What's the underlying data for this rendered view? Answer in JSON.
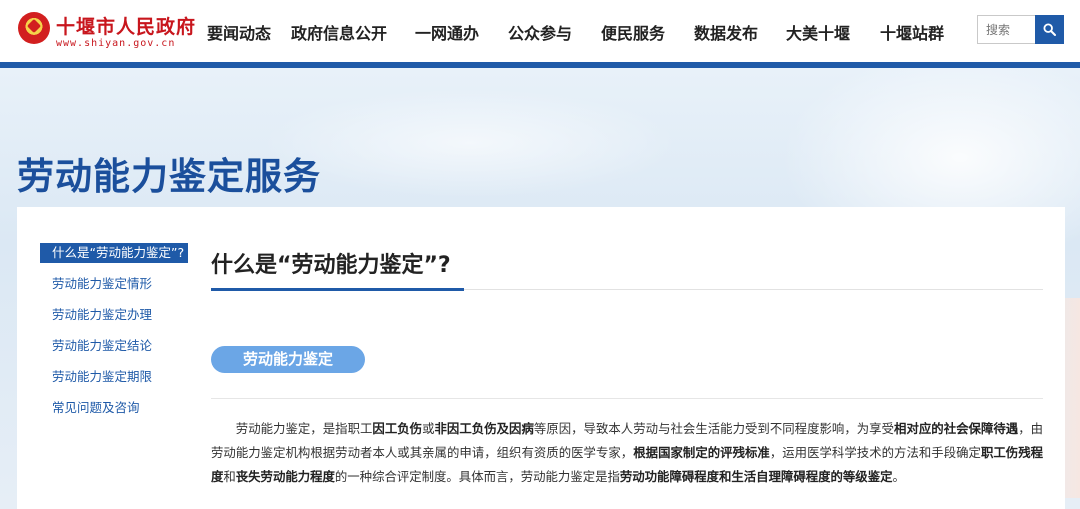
{
  "header": {
    "logo_title": "十堰市人民政府",
    "logo_url": "www.shiyan.gov.cn",
    "nav": [
      "要闻动态",
      "政府信息公开",
      "一网通办",
      "公众参与",
      "便民服务",
      "数据发布",
      "大美十堰",
      "十堰站群"
    ],
    "search_placeholder": "搜索",
    "accent_color": "#1f5aa8"
  },
  "banner": {
    "title": "劳动能力鉴定服务"
  },
  "sidebar": {
    "items": [
      {
        "label": "什么是“劳动能力鉴定”?",
        "active": true
      },
      {
        "label": "劳动能力鉴定情形",
        "active": false
      },
      {
        "label": "劳动能力鉴定办理",
        "active": false
      },
      {
        "label": "劳动能力鉴定结论",
        "active": false
      },
      {
        "label": "劳动能力鉴定期限",
        "active": false
      },
      {
        "label": "常见问题及咨询",
        "active": false
      }
    ]
  },
  "main": {
    "title": "什么是“劳动能力鉴定”?",
    "pill": "劳动能力鉴定",
    "paragraph": [
      {
        "t": "劳动能力鉴定，是指职工",
        "b": false
      },
      {
        "t": "因工负伤",
        "b": true
      },
      {
        "t": "或",
        "b": false
      },
      {
        "t": "非因工负伤及因病",
        "b": true
      },
      {
        "t": "等原因，导致本人劳动与社会生活能力受到不同程度影响，为享受",
        "b": false
      },
      {
        "t": "相对应的社会保障待遇",
        "b": true
      },
      {
        "t": "，由劳动能力鉴定机构根据劳动者本人或其亲属的申请，组织有资质的医学专家，",
        "b": false
      },
      {
        "t": "根据国家制定的评残标准",
        "b": true
      },
      {
        "t": "，运用医学科学技术的方法和手段确定",
        "b": false
      },
      {
        "t": "职工伤残程度",
        "b": true
      },
      {
        "t": "和",
        "b": false
      },
      {
        "t": "丧失劳动能力程度",
        "b": true
      },
      {
        "t": "的一种综合评定制度。具体而言，劳动能力鉴定是指",
        "b": false
      },
      {
        "t": "劳动功能障碍程度和生活自理障碍程度的等级鉴定",
        "b": true
      },
      {
        "t": "。",
        "b": false
      }
    ]
  }
}
